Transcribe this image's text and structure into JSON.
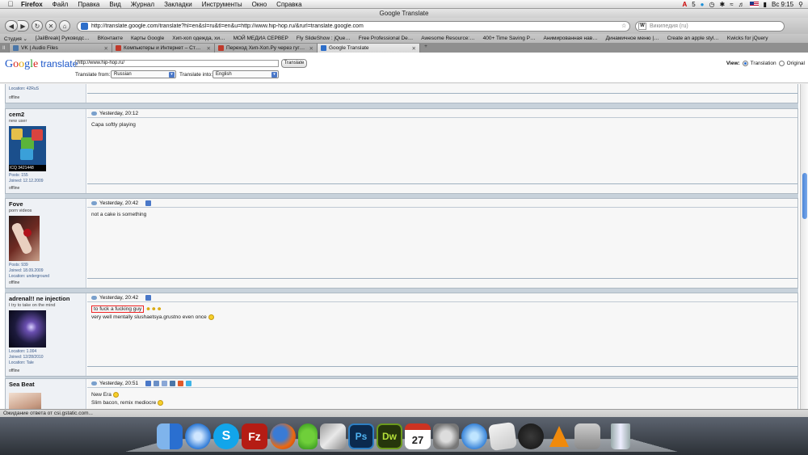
{
  "menubar": {
    "app": "Firefox",
    "items": [
      "Файл",
      "Правка",
      "Вид",
      "Журнал",
      "Закладки",
      "Инструменты",
      "Окно",
      "Справка"
    ],
    "badge": "5",
    "clock": "Вс 9:15"
  },
  "window": {
    "title": "Google Translate"
  },
  "toolbar": {
    "url": "http://translate.google.com/translate?hl=en&sl=ru&tl=en&u=http://www.hip-hop.ru/&rurl=translate.google.com",
    "search_placeholder": "Википедия (ru)",
    "search_engine_letter": "W"
  },
  "bookmarks": [
    "Студия ⌄",
    "[JailBreak] Руководс…",
    "ВКонтакте",
    "Карты Google",
    "Хип-хоп одежда, хи…",
    "МОЙ МЕДИА СЕРВЕР",
    "Fly SlideShow : jQue…",
    "Free Professional De…",
    "Awesome Resource:…",
    "400+ Time Saving P…",
    "Анимированная нав…",
    "Динамичное меню |…",
    "Create an apple styl…",
    "Kwicks for jQuery"
  ],
  "tabs": [
    {
      "label": "VK | Audio Files",
      "active": false
    },
    {
      "label": "Компьютеры и Интернет – Ст…",
      "active": false
    },
    {
      "label": "Переход Хип-Хоп.Ру через гуг…",
      "active": false
    },
    {
      "label": "Google Translate",
      "active": true
    }
  ],
  "translate_bar": {
    "logo_google": "Google",
    "logo_translate": "translate",
    "url_value": "http://www.hip-hop.ru/",
    "translate_button": "Translate",
    "from_label": "Translate from:",
    "from_value": "Russian",
    "into_label": "Translate into:",
    "into_value": "English",
    "view_label": "View:",
    "view_translation": "Translation",
    "view_original": "Original"
  },
  "posts": [
    {
      "username": "",
      "user_title": "",
      "info": [
        "Location: 42RuS"
      ],
      "status": "offline",
      "time": "",
      "lines": []
    },
    {
      "username": "cem2",
      "user_title": "new user",
      "avatar_text": "ICQ 3421448",
      "info": [
        "Posts: 155",
        "Joined: 12.12.2009"
      ],
      "status": "offline",
      "time": "Yesterday, 20:12",
      "lines": [
        "Capa softly playing"
      ]
    },
    {
      "username": "Fove",
      "user_title": "porn videos",
      "info": [
        "Posts: 939",
        "Joined: 18.09.2009",
        "Location: underground"
      ],
      "status": "offline",
      "time": "Yesterday, 20:42",
      "lines": [
        "not a cake is something"
      ]
    },
    {
      "username": "adrenal!! ne injection",
      "user_title": "I try to take on the mind",
      "info": [
        "Location: 1.004",
        "Joined: 12/28/2010",
        "Location: Tale"
      ],
      "status": "offline",
      "time": "Yesterday, 20:42",
      "highlight": "to fuck a fucking guy",
      "lines": [
        "very well mentally slushaetsya.grustno even once"
      ]
    },
    {
      "username": "Sea Beat",
      "user_title": "",
      "info": [],
      "status": "",
      "time": "Yesterday, 20:51",
      "lines": [
        "New Era",
        "Slim bacon, remix mediocre"
      ]
    }
  ],
  "statusbar": {
    "text": "Ожидание ответа от csi.gstatic.com..."
  },
  "dock": {
    "icons": [
      "finder-icon",
      "safari-icon",
      "skype-icon",
      "filezilla-icon",
      "firefox-icon",
      "adium-icon",
      "parallels-icon",
      "photoshop-icon",
      "dreamweaver-icon",
      "ical-icon",
      "system-preferences-icon",
      "itunes-icon",
      "preview-icon",
      "xbmc-icon",
      "vlc-icon",
      "automator-icon",
      "trash-icon"
    ],
    "labels": {
      "photoshop": "Ps",
      "dreamweaver": "Dw",
      "filezilla": "Fz",
      "ical_day": "27",
      "skype": "S"
    }
  }
}
